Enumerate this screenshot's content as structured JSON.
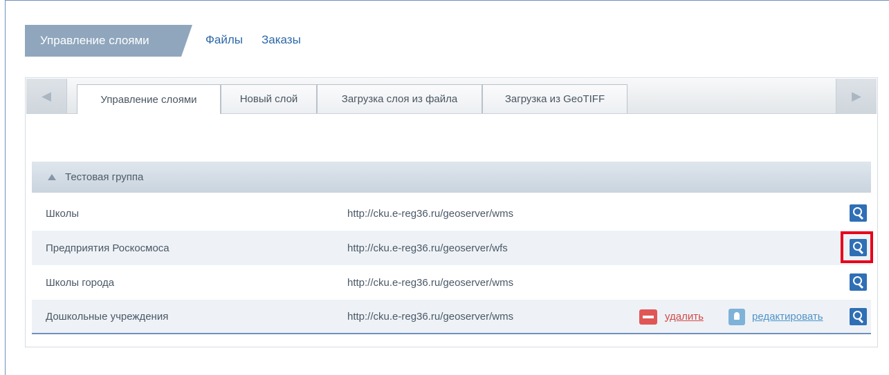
{
  "top_tabs": [
    "Управление слоями",
    "Файлы",
    "Заказы"
  ],
  "inner_tabs": [
    "Управление слоями",
    "Новый слой",
    "Загрузка слоя из файла",
    "Загрузка из GeoTIFF"
  ],
  "nav_icons": {
    "left": "triangle-left-icon",
    "right": "triangle-right-icon"
  },
  "group": {
    "label": "Тестовая группа",
    "icon": "triangle-up-icon"
  },
  "rows": [
    {
      "name": "Школы",
      "url": "http://cku.e-reg36.ru/geoserver/wms"
    },
    {
      "name": "Предприятия Роскосмоса",
      "url": "http://cku.e-reg36.ru/geoserver/wfs"
    },
    {
      "name": "Школы города",
      "url": "http://cku.e-reg36.ru/geoserver/wms"
    },
    {
      "name": "Дошкольные учреждения",
      "url": "http://cku.e-reg36.ru/geoserver/wms"
    }
  ],
  "actions": {
    "delete_label": "удалить",
    "edit_label": "редактировать"
  },
  "colors": {
    "accent": "#2f6fb5",
    "tab_active": "#8fa6bd",
    "highlight": "#e8001b",
    "delete": "#e05656"
  }
}
